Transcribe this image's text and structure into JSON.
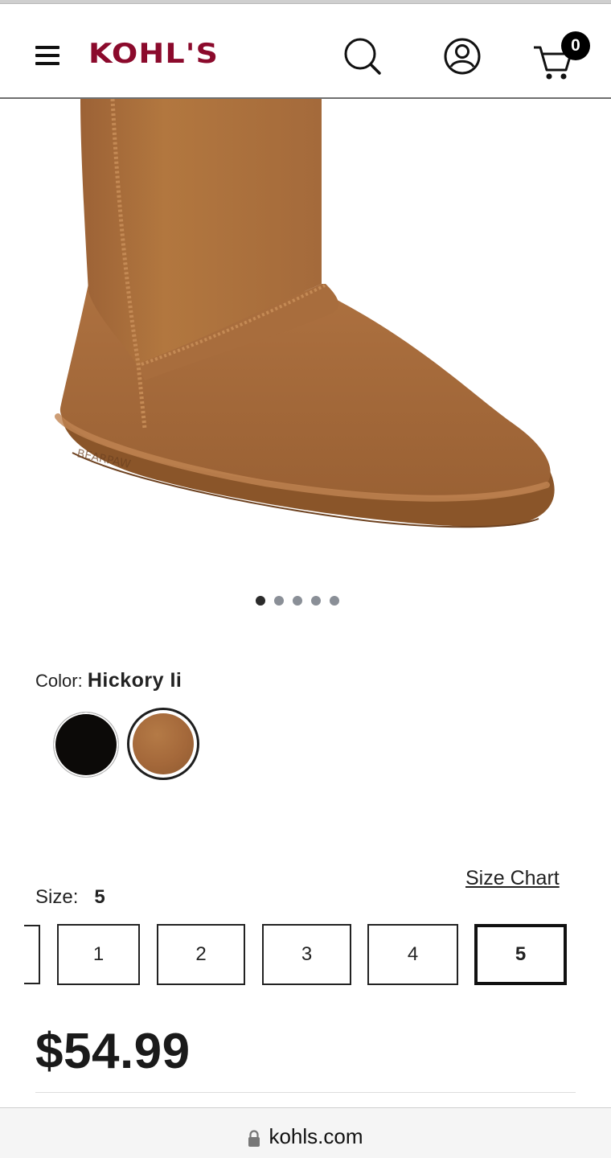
{
  "header": {
    "logo_text": "KOHL'S",
    "cart_count": "0",
    "icons": [
      "menu-icon",
      "search-icon",
      "account-icon",
      "cart-icon"
    ]
  },
  "gallery": {
    "image": "brown suede sheepskin boot",
    "slide_count": 5,
    "active_slide": 1
  },
  "color": {
    "label": "Color:",
    "selected": "Hickory Ii",
    "swatches": [
      "black",
      "hickory"
    ]
  },
  "size": {
    "chart_link": "Size Chart",
    "label": "Size:",
    "selected": "5",
    "options": [
      "1",
      "2",
      "3",
      "4",
      "5"
    ]
  },
  "price": "$54.99",
  "browser": {
    "url": "kohls.com"
  },
  "colors": {
    "brand": "#8b0a2c",
    "text": "#1a1a1a",
    "boot": "#a86e3f"
  }
}
